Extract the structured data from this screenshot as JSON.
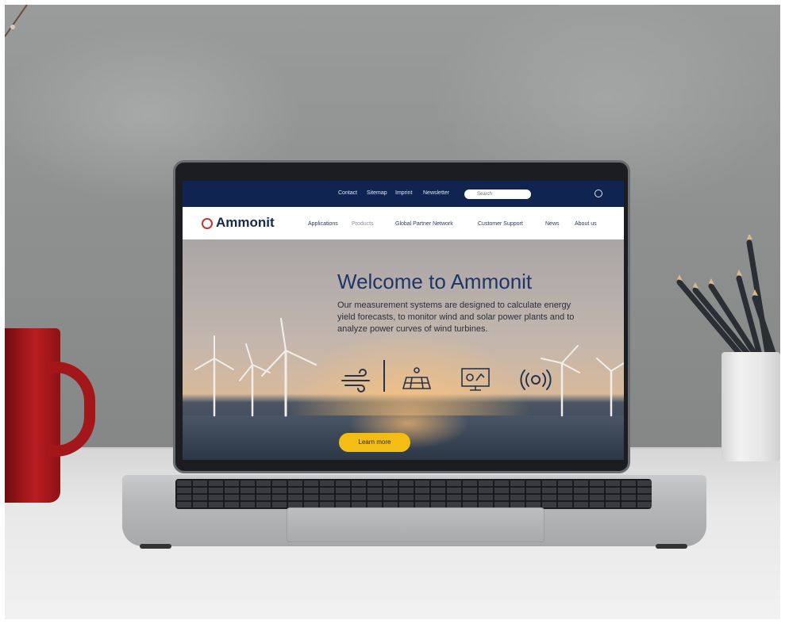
{
  "topbar": {
    "links": [
      "Contact",
      "Sitemap",
      "Imprint",
      "Newsletter"
    ],
    "search_placeholder": "Search"
  },
  "navbar": {
    "logo": "Ammonit",
    "items": [
      "Applications",
      "Products",
      "Global Partner Network",
      "Customer Support",
      "News",
      "About us"
    ]
  },
  "hero": {
    "title": "Welcome to Ammonit",
    "text": "Our measurement systems are designed to calculate energy yield forecasts, to monitor wind and solar power plants and to analyze power curves of wind turbines.",
    "cta_label": "Learn more"
  },
  "colors": {
    "topbar": "#0f2450",
    "logo_text": "#142a52",
    "title": "#1f3569",
    "cta": "#f3bd14",
    "logo_mark": "#c7342c"
  }
}
